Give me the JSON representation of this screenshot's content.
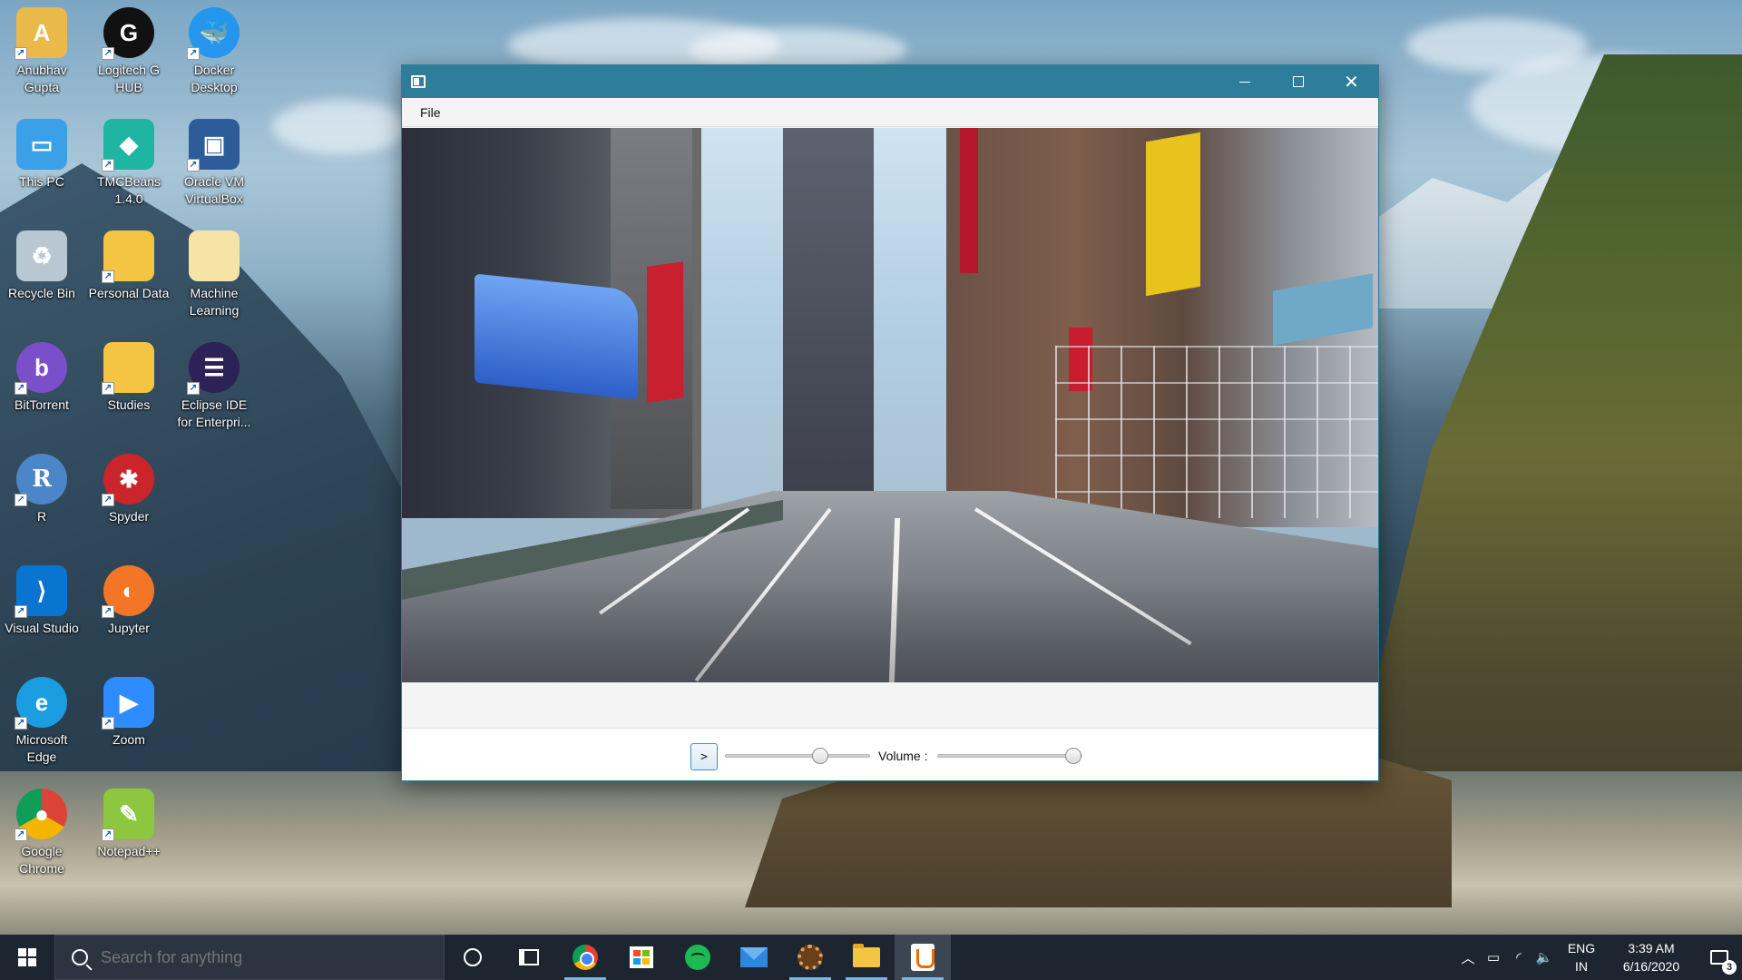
{
  "desktop": {
    "icons": [
      {
        "label": "Anubhav Gupta",
        "icon": "user-folder-icon",
        "color": "#e9b949"
      },
      {
        "label": "Logitech G HUB",
        "icon": "logitech-icon",
        "color": "#111111"
      },
      {
        "label": "Docker Desktop",
        "icon": "docker-icon",
        "color": "#2496ed"
      },
      {
        "label": "This PC",
        "icon": "computer-icon",
        "color": "#3aa0e8"
      },
      {
        "label": "TMCBeans 1.4.0",
        "icon": "tmcbeans-icon",
        "color": "#1fb5a3"
      },
      {
        "label": "Oracle VM VirtualBox",
        "icon": "virtualbox-icon",
        "color": "#2d5c9a"
      },
      {
        "label": "Recycle Bin",
        "icon": "recycle-bin-icon",
        "color": "#b8c7d2"
      },
      {
        "label": "Personal Data",
        "icon": "folder-icon",
        "color": "#f4c542"
      },
      {
        "label": "Machine Learning",
        "icon": "file-icon",
        "color": "#f6e3a6"
      },
      {
        "label": "BitTorrent",
        "icon": "bittorrent-icon",
        "color": "#7a4fc9"
      },
      {
        "label": "Studies",
        "icon": "folder-icon",
        "color": "#f4c542"
      },
      {
        "label": "Eclipse IDE for Enterpri...",
        "icon": "eclipse-icon",
        "color": "#2c2255"
      },
      {
        "label": "R",
        "icon": "r-icon",
        "color": "#4b87c8"
      },
      {
        "label": "Spyder",
        "icon": "spyder-icon",
        "color": "#c9252b"
      },
      {
        "label": "Visual Studio",
        "icon": "visual-studio-icon",
        "color": "#0a74d1"
      },
      {
        "label": "Jupyter",
        "icon": "jupyter-icon",
        "color": "#f37626"
      },
      {
        "label": "Microsoft Edge",
        "icon": "edge-icon",
        "color": "#1b9de2"
      },
      {
        "label": "Zoom",
        "icon": "zoom-icon",
        "color": "#2d8cff"
      },
      {
        "label": "Google Chrome",
        "icon": "chrome-icon",
        "color": "#db4437"
      },
      {
        "label": "Notepad++",
        "icon": "notepadpp-icon",
        "color": "#8dc63f"
      }
    ]
  },
  "window": {
    "title_icon": "app-window-icon",
    "controls": {
      "minimize": "minimize-icon",
      "maximize": "maximize-icon",
      "close": "✕"
    },
    "menu": [
      "File"
    ],
    "player": {
      "play_label": ">",
      "seek_fraction": 0.68,
      "volume_label": "Volume :",
      "volume_fraction": 1.0
    }
  },
  "taskbar": {
    "search_placeholder": "Search for anything",
    "apps": [
      "cortana-icon",
      "task-view-icon",
      "chrome-icon",
      "microsoft-store-icon",
      "spotify-icon",
      "mail-icon",
      "settings-app-icon",
      "file-explorer-icon",
      "java-app-icon"
    ],
    "tray": {
      "lang_top": "ENG",
      "lang_bottom": "IN",
      "time": "3:39 AM",
      "date": "6/16/2020",
      "notifications": "3"
    }
  }
}
